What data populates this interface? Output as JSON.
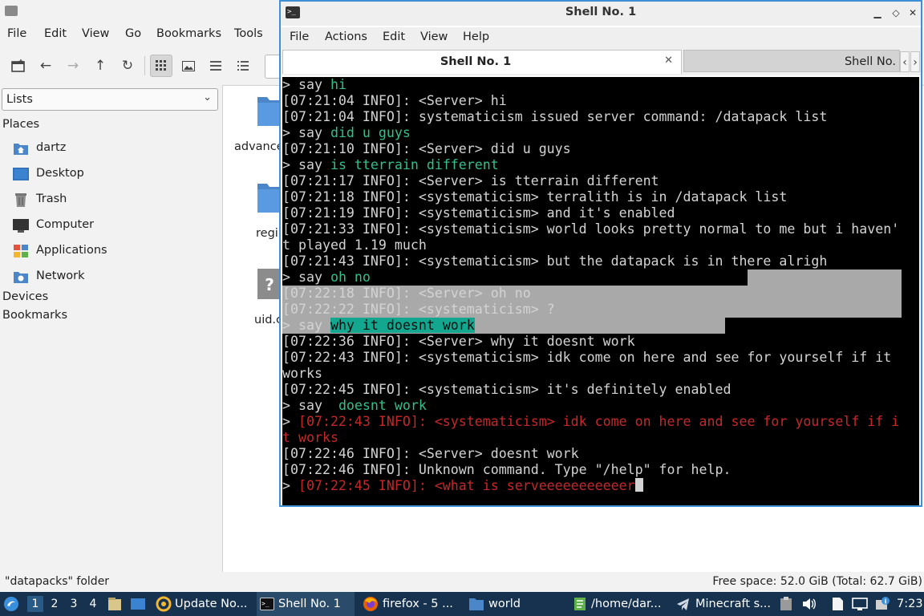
{
  "file_manager": {
    "menu": [
      "File",
      "Edit",
      "View",
      "Go",
      "Bookmarks",
      "Tools"
    ],
    "sidebar": {
      "select_value": "Lists",
      "places_heading": "Places",
      "places": [
        {
          "label": "dartz",
          "icon": "home-folder-icon"
        },
        {
          "label": "Desktop",
          "icon": "desktop-icon"
        },
        {
          "label": "Trash",
          "icon": "trash-icon"
        },
        {
          "label": "Computer",
          "icon": "computer-icon"
        },
        {
          "label": "Applications",
          "icon": "applications-icon"
        },
        {
          "label": "Network",
          "icon": "network-icon"
        }
      ],
      "devices_heading": "Devices",
      "bookmarks_heading": "Bookmarks"
    },
    "files": [
      "advance",
      "regi",
      "uid.c"
    ],
    "status_left": "\"datapacks\" folder",
    "status_right": "Free space: 52.0 GiB (Total: 62.7 GiB)"
  },
  "terminal": {
    "title": "Shell No. 1",
    "menu": [
      "File",
      "Actions",
      "Edit",
      "View",
      "Help"
    ],
    "tabs": [
      "Shell No. 1",
      "Shell No."
    ],
    "lines": [
      {
        "prefix": "> say ",
        "body": "hi",
        "style": "green"
      },
      {
        "body": "[07:21:04 INFO]: <Server> hi"
      },
      {
        "body": "[07:21:04 INFO]: systematicism issued server command: /datapack list"
      },
      {
        "prefix": "> say ",
        "body": "did u guys",
        "style": "green"
      },
      {
        "body": "[07:21:10 INFO]: <Server> did u guys"
      },
      {
        "prefix": "> say ",
        "body": "is tterrain different",
        "style": "green"
      },
      {
        "body": "[07:21:17 INFO]: <Server> is tterrain different"
      },
      {
        "body": "[07:21:18 INFO]: <systematicism> terralith is in /datapack list"
      },
      {
        "body": "[07:21:19 INFO]: <systematicism> and it's enabled"
      },
      {
        "body": "[07:21:33 INFO]: <systematicism> world looks pretty normal to me but i haven'"
      },
      {
        "body": "t played 1.19 much"
      },
      {
        "body": "[07:21:43 INFO]: <systematicism> but the datapack is in there alrigh"
      },
      {
        "prefix": "> say ",
        "body": "oh no",
        "style": "green"
      },
      {
        "body": "[07:22:18 INFO]: <Server> oh no"
      },
      {
        "body": "[07:22:22 INFO]: <systematicism> ?"
      },
      {
        "prefix": "> say ",
        "body": "why it doesnt work",
        "style": "highlight"
      },
      {
        "body": "[07:22:36 INFO]: <Server> why it doesnt work"
      },
      {
        "body": "[07:22:43 INFO]: <systematicism> idk come on here and see for yourself if it"
      },
      {
        "body": "works"
      },
      {
        "body": "[07:22:45 INFO]: <systematicism> it's definitely enabled"
      },
      {
        "prefix": "> say  ",
        "body": "doesnt work",
        "style": "green"
      },
      {
        "prefix": "> ",
        "body": "[07:22:43 INFO]: <systematicism> idk come on here and see for yourself if i",
        "style": "red"
      },
      {
        "body": "t works",
        "style": "red"
      },
      {
        "body": "[07:22:46 INFO]: <Server> doesnt work"
      },
      {
        "body": "[07:22:46 INFO]: Unknown command. Type \"/help\" for help."
      },
      {
        "prefix": "> ",
        "body": "[07:22:45 INFO]: <what is serveeeeeeeeeeer",
        "style": "red",
        "cursor": true
      }
    ]
  },
  "panel": {
    "workspaces": [
      "1",
      "2",
      "3",
      "4"
    ],
    "tasks": [
      {
        "label": "Update No...",
        "icon": "update-icon"
      },
      {
        "label": "Shell No. 1",
        "icon": "terminal-icon"
      },
      {
        "label": "firefox - 5 ...",
        "icon": "firefox-icon"
      },
      {
        "label": "world",
        "icon": "folder-icon"
      },
      {
        "label": "/home/dar...",
        "icon": "editor-icon"
      },
      {
        "label": "Minecraft s...",
        "icon": "telegram-icon"
      }
    ],
    "clock": "7:23"
  },
  "colors": {
    "terminal_border": "#3d8fd6",
    "panel_bg": "#16324f",
    "term_green": "#33c08a",
    "term_red": "#c8272a",
    "term_highlight": "#14a78f"
  }
}
